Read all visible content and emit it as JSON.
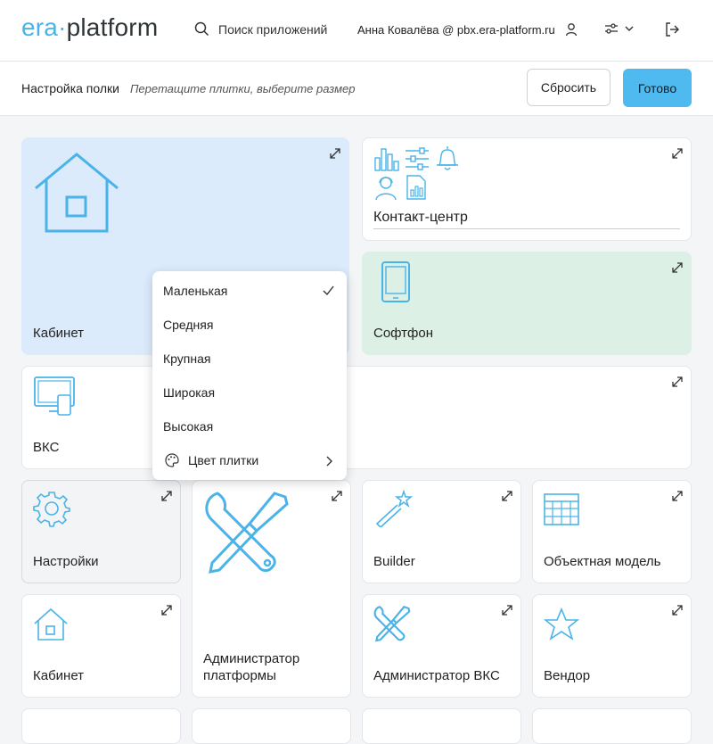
{
  "header": {
    "logo_era": "era",
    "logo_dot": "·",
    "logo_platform": "platform",
    "search_label": "Поиск приложений",
    "user_label": "Анна Ковалёва @ pbx.era-platform.ru"
  },
  "subbar": {
    "title": "Настройка полки",
    "hint": "Перетащите плитки, выберите размер",
    "reset_label": "Сбросить",
    "done_label": "Готово"
  },
  "tiles": {
    "cabinet_large": "Кабинет",
    "contact_center": "Контакт-центр",
    "softphone": "Софтфон",
    "vks": "ВКС",
    "settings": "Настройки",
    "admin_platform_1": "Администратор",
    "admin_platform_2": "платформы",
    "builder": "Builder",
    "object_model": "Объектная модель",
    "cabinet_small": "Кабинет",
    "admin_vks": "Администратор ВКС",
    "vendor": "Вендор"
  },
  "size_menu": {
    "small": "Маленькая",
    "medium": "Средняя",
    "large": "Крупная",
    "wide": "Широкая",
    "tall": "Высокая",
    "color": "Цвет плитки"
  },
  "colors": {
    "accent": "#4fbaf0",
    "icon": "#4ab3e8"
  }
}
